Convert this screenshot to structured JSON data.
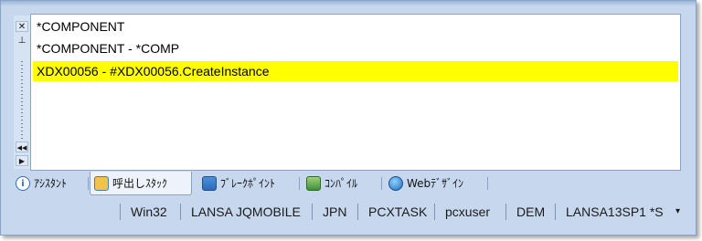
{
  "list": {
    "rows": [
      {
        "text": "*COMPONENT",
        "highlighted": false
      },
      {
        "text": "*COMPONENT - *COMP",
        "highlighted": false
      },
      {
        "text": "XDX00056 - #XDX00056.CreateInstance",
        "highlighted": true
      }
    ],
    "highlight_color": "#ffff00"
  },
  "left_toolbar": {
    "close_glyph": "✕",
    "pin_glyph": "⊥",
    "rewind_glyph": "◀◀",
    "play_glyph": "▶"
  },
  "tabs": [
    {
      "label": "ｱｼｽﾀﾝﾄ",
      "icon": "info-icon",
      "active": false
    },
    {
      "label": "呼出しｽﾀｯｸ",
      "icon": "call-stack-icon",
      "active": true
    },
    {
      "label": "ﾌﾞﾚｰｸﾎﾟｲﾝﾄ",
      "icon": "breakpoint-icon",
      "active": false
    },
    {
      "label": "ｺﾝﾊﾟｲﾙ",
      "icon": "compile-icon",
      "active": false
    },
    {
      "label": "Webﾃﾞｻﾞｲﾝ",
      "icon": "web-globe-icon",
      "active": false
    }
  ],
  "status_bar": {
    "platform": "Win32",
    "framework": "LANSA JQMOBILE",
    "language": "JPN",
    "task": "PCXTASK",
    "user": "pcxuser",
    "partition": "DEM",
    "version": "LANSA13SP1 *S",
    "more_glyph": "▾"
  }
}
